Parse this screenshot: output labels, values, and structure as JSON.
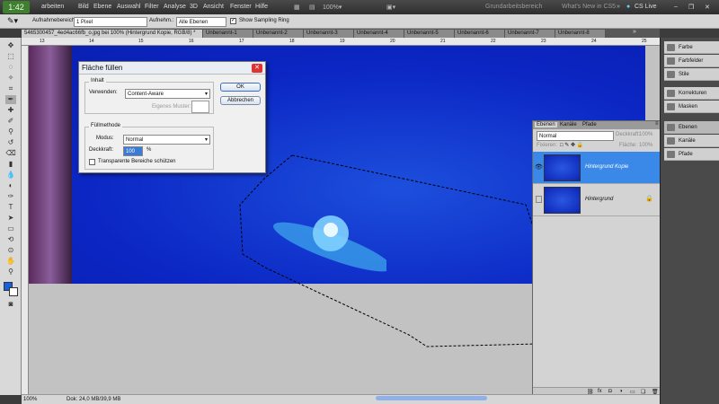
{
  "status_time": "1:42",
  "menu": [
    "arbeiten",
    "Bild",
    "Ebene",
    "Auswahl",
    "Filter",
    "Analyse",
    "3D",
    "Ansicht",
    "Fenster",
    "Hilfe"
  ],
  "workspace": {
    "grundarbeitsbereich": "Grundarbeitsbereich",
    "whats_new": "What's New in CS5",
    "cs_live": "CS Live"
  },
  "options": {
    "sample_size_label": "Aufnahmebereich:",
    "sample_size_value": "1 Pixel",
    "sample_label": "Aufnehm.:",
    "sample_value": "Alle Ebenen",
    "sampling_ring": "Show Sampling Ring"
  },
  "tabs": [
    "5465300457_4ed4ac66fb_o.jpg bei 100% (Hintergrund Kopie, RGB/8) *",
    "Unbenannt-1",
    "Unbenannt-2",
    "Unbenannt-3",
    "Unbenannt-4",
    "Unbenannt-5",
    "Unbenannt-6",
    "Unbenannt-7",
    "Unbenannt-8"
  ],
  "ruler_ticks": [
    "13",
    "14",
    "15",
    "16",
    "17",
    "18",
    "19",
    "20",
    "21",
    "22",
    "23",
    "24",
    "25"
  ],
  "statusbar": {
    "zoom": "100%",
    "doc": "Dok: 24,0 MB/39,9 MB"
  },
  "dock": [
    "Farbe",
    "Farbfelder",
    "Stile",
    "Korrekturen",
    "Masken",
    "Ebenen",
    "Kanäle",
    "Pfade"
  ],
  "dialog": {
    "title": "Fläche füllen",
    "inhalt": "Inhalt",
    "verwenden_label": "Verwenden:",
    "verwenden_value": "Content-Aware",
    "muster_label": "Eigenes Muster:",
    "fuellmethode": "Füllmethode",
    "modus_label": "Modus:",
    "modus_value": "Normal",
    "deckkraft_label": "Deckkraft:",
    "deckkraft_value": "100",
    "percent": "%",
    "transparent": "Transparente Bereiche schützen",
    "ok": "OK",
    "abbrechen": "Abbrechen"
  },
  "layers_panel": {
    "tabs": [
      "Ebenen",
      "Kanäle",
      "Pfade"
    ],
    "blend": "Normal",
    "opacity_label": "Deckkraft:",
    "opacity_value": "100%",
    "fill_label": "Fläche:",
    "fill_value": "100%",
    "fix_label": "Fixieren:",
    "layers": [
      "Hintergrund Kopie",
      "Hintergrund"
    ]
  }
}
